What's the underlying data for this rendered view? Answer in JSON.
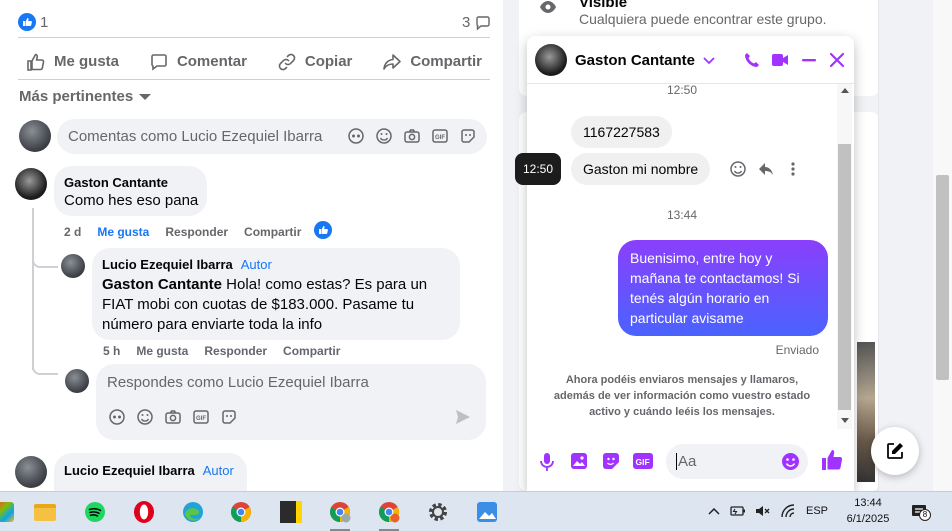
{
  "post": {
    "like_count": "1",
    "comment_count": "3",
    "actions": {
      "like": "Me gusta",
      "comment": "Comentar",
      "copy": "Copiar",
      "share": "Compartir"
    },
    "sort_label": "Más pertinentes",
    "comment_placeholder": "Comentas como Lucio Ezequiel Ibarra",
    "comments": [
      {
        "author": "Gaston Cantante",
        "text": "Como hes eso pana",
        "time": "2 d",
        "like": "Me gusta",
        "reply": "Responder",
        "share": "Compartir"
      },
      {
        "author": "Lucio Ezequiel Ibarra",
        "badge": "Autor",
        "mention": "Gaston Cantante",
        "text": " Hola! como estas? Es para un FIAT mobi con cuotas de $183.000. Pasame tu número para enviarte toda la info",
        "time": "5 h",
        "like": "Me gusta",
        "reply": "Responder",
        "share": "Compartir"
      },
      {
        "author": "Lucio Ezequiel Ibarra",
        "badge": "Autor"
      }
    ],
    "reply_placeholder": "Respondes como Lucio Ezequiel Ibarra"
  },
  "group": {
    "visibility_title": "Visible",
    "visibility_desc": "Cualquiera puede encontrar este grupo."
  },
  "chat": {
    "contact_name": "Gaston Cantante",
    "timestamps": [
      "12:50",
      "13:44"
    ],
    "hover_time": "12:50",
    "messages_in": [
      "1167227583",
      "Gaston mi nombre"
    ],
    "message_out": "Buenisimo, entre hoy y mañana te contactamos! Si tenés algún horario en particular avisame",
    "status": "Enviado",
    "notice": "Ahora podéis enviaros mensajes y llamaros, además de ver información como vuestro estado activo y cuándo leéis los mensajes.",
    "input_placeholder": "Aa",
    "colors": {
      "accent": "#a033ff",
      "out_top": "#8a3ffc",
      "out_bottom": "#4a63ff"
    }
  },
  "taskbar": {
    "language": "ESP",
    "time": "13:44",
    "date": "6/1/2025",
    "notification_count": "8"
  }
}
